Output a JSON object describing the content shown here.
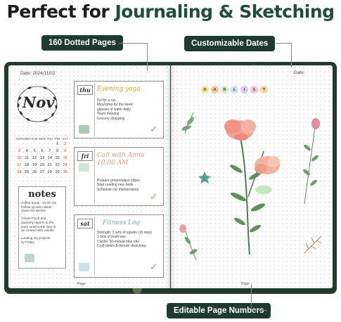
{
  "headline": {
    "lead": "Perfect for ",
    "emphasis": "Journaling & Sketching"
  },
  "tags": {
    "pages": "160 Dotted Pages",
    "dates": "Customizable Dates",
    "numbers": "Editable Page Numbers"
  },
  "left_page": {
    "date": "Date: 2024/11/02",
    "month": "Nov",
    "calendar_header": [
      "SUN",
      "MON",
      "TUE",
      "WED",
      "THU",
      "FRI",
      "SAT"
    ],
    "calendar_rows": [
      [
        "",
        "",
        "",
        "",
        "",
        "1",
        "2"
      ],
      [
        "3",
        "4",
        "5",
        "6",
        "7",
        "8",
        "9"
      ],
      [
        "10",
        "11",
        "12",
        "13",
        "14",
        "15",
        "16"
      ],
      [
        "17",
        "18",
        "19",
        "20",
        "21",
        "22",
        "23"
      ],
      [
        "24",
        "25",
        "26",
        "27",
        "28",
        "29",
        "30"
      ]
    ],
    "notes_title": "notes",
    "notes": [
      "Coffee break - 10:00 AM",
      "Follow up with clients",
      "Clean the kitchen",
      "",
      "Cream Finch and",
      "quarterly reports to the",
      "team need some time to",
      "be created with visuals",
      "",
      "Landing my projects",
      "by Friday"
    ],
    "cards": [
      {
        "day": "thu",
        "heading": "Evening yoga",
        "items": [
          "Go for a run",
          "Meal prep for the week",
          "glasses of water daily",
          "Team meeting",
          "Grocery shopping"
        ],
        "color": "#e3c94f"
      },
      {
        "day": "fri",
        "heading": "Call with Anna",
        "heading2": "10:00 AM",
        "items": [
          "Prepare presentation slides",
          "Start reading new book",
          "Schedule car maintenance"
        ],
        "color": "#e99a6e"
      },
      {
        "day": "sat",
        "heading": "Fitness Log",
        "items": [
          "Strength: 3 sets of squats (15 reps)",
          "3 sets of push-ups",
          "Cardio: 30-minute bike ride",
          "Cool-down: 5-minute stretching"
        ],
        "color": "#6fa8c4"
      }
    ],
    "page_label": "Page"
  },
  "right_page": {
    "date": "Date:",
    "letters": [
      "D",
      "A",
      "R",
      "L",
      "I",
      "S",
      "T"
    ],
    "letter_colors": [
      "#f3e79b",
      "#f5c9a6",
      "#d9ecc9",
      "#cfe0f1",
      "#dcc9ec",
      "#f3c5d8",
      "#f5d9a0"
    ],
    "page_label": "Page"
  }
}
